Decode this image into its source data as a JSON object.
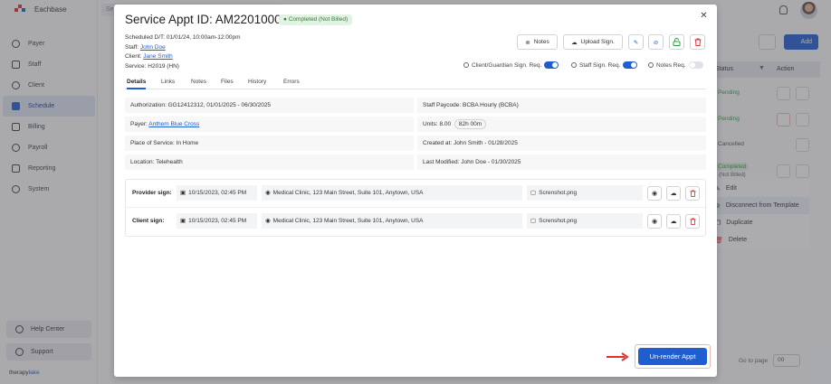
{
  "app": {
    "brand": "Eachbase",
    "footer_brand_a": "therapy",
    "footer_brand_b": "lake",
    "nav": [
      {
        "label": "Payer"
      },
      {
        "label": "Staff"
      },
      {
        "label": "Client"
      },
      {
        "label": "Schedule"
      },
      {
        "label": "Billing"
      },
      {
        "label": "Payroll"
      },
      {
        "label": "Reporting"
      },
      {
        "label": "System"
      }
    ],
    "help_center": "Help Center",
    "support": "Support",
    "search_placeholder": "Se",
    "add_label": "Add",
    "table": {
      "col_status": "Status",
      "col_action": "Action",
      "rows": [
        {
          "status": "Pending",
          "status_color": "#2f9e44"
        },
        {
          "status": "Pending",
          "status_color": "#2f9e44"
        },
        {
          "status": "Cancelled",
          "status_color": "#555555"
        },
        {
          "status": "Completed",
          "sub": "(Not Billed)",
          "status_color": "#2f9e44"
        }
      ]
    },
    "row_menu": [
      "Edit",
      "Disconnect from Template",
      "Duplicate",
      "Delete"
    ],
    "go_to_page": "Go to page",
    "page_size": "00"
  },
  "modal": {
    "title": "Service Appt ID: AM220100001",
    "status_badge": "Completed (Not Billed)",
    "status_color": "#2f7d32",
    "scheduled_label": "Scheduled D/T:",
    "scheduled_value": "01/01/24, 10:00am-12:00pm",
    "staff_label": "Staff:",
    "staff_value": "John Doe",
    "client_label": "Client:",
    "client_value": "Jane Smith",
    "service_label": "Service:",
    "service_value": "H2019 (HN)",
    "notes_btn": "Notes",
    "upload_sign_btn": "Upload Sign.",
    "toggles": [
      {
        "label": "Client/Guardian Sign. Req.",
        "on": true
      },
      {
        "label": "Staff Sign. Req.",
        "on": true
      },
      {
        "label": "Notes Req.",
        "on": false
      }
    ],
    "tabs": [
      "Details",
      "Links",
      "Notes",
      "Files",
      "History",
      "Errors"
    ],
    "active_tab": "Details",
    "authorization_label": "Authorization:",
    "authorization_value": "GG12412312, 01/01/2025 - 06/30/2025",
    "paycode_label": "Staff Paycode:",
    "paycode_value": "BCBA Hourly (BCBA)",
    "payer_label": "Payer:",
    "payer_value": "Anthem Blue Cross",
    "units_label": "Units:",
    "units_value": "8.00",
    "units_pill": "82h 00m",
    "pos_label": "Place of Service:",
    "pos_value": "In Home",
    "created_label": "Created at:",
    "created_value": "John Smith - 01/28/2025",
    "location_label": "Location:",
    "location_value": "Telehealth",
    "modified_label": "Last Modified:",
    "modified_value": "John Doe - 01/30/2025",
    "signatures": [
      {
        "label": "Provider sign:",
        "datetime": "10/15/2023, 02:45 PM",
        "address": "Medical Clinic, 123 Main Street, Suite 101, Anytown, USA",
        "file": "Screnshot.png"
      },
      {
        "label": "Client sign:",
        "datetime": "10/15/2023, 02:45 PM",
        "address": "Medical Clinic, 123 Main Street, Suite 101, Anytown, USA",
        "file": "Screnshot.png"
      }
    ],
    "unrender_btn": "Un-render Appt",
    "accent_color": "#1f5ecf",
    "danger_color": "#e03131",
    "success_color": "#2f9e44"
  }
}
